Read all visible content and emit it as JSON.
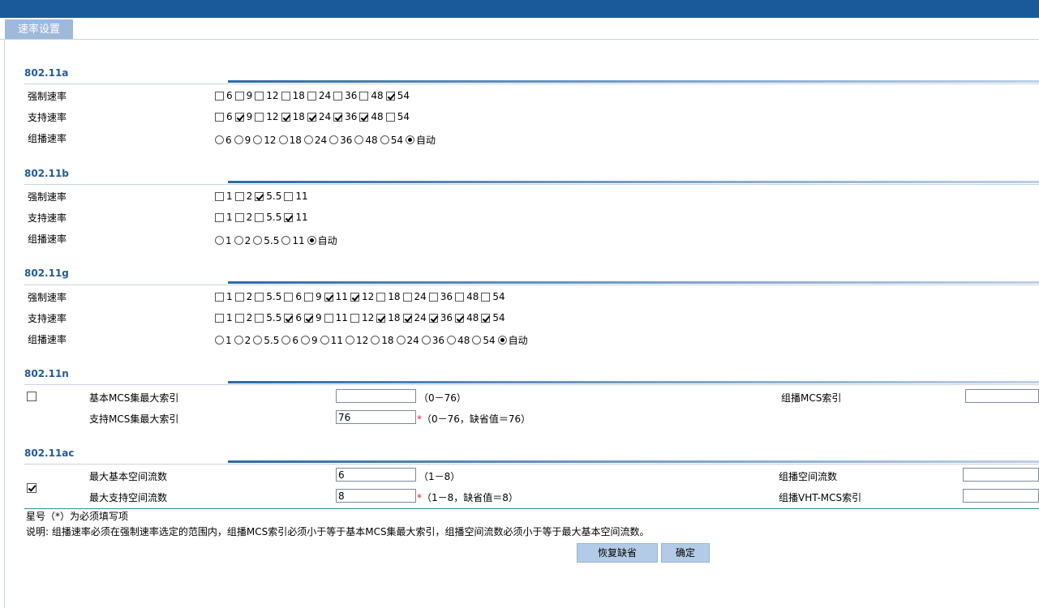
{
  "tab": {
    "label": "速率设置"
  },
  "labels": {
    "mandatory": "强制速率",
    "supported": "支持速率",
    "multicast": "组播速率"
  },
  "sections": [
    {
      "title": "802.11a",
      "mandatory": [
        {
          "v": "6",
          "on": false
        },
        {
          "v": "9",
          "on": false
        },
        {
          "v": "12",
          "on": false
        },
        {
          "v": "18",
          "on": false
        },
        {
          "v": "24",
          "on": false
        },
        {
          "v": "36",
          "on": false
        },
        {
          "v": "48",
          "on": false
        },
        {
          "v": "54",
          "on": true
        }
      ],
      "supported": [
        {
          "v": "6",
          "on": false
        },
        {
          "v": "9",
          "on": true
        },
        {
          "v": "12",
          "on": false
        },
        {
          "v": "18",
          "on": true
        },
        {
          "v": "24",
          "on": true
        },
        {
          "v": "36",
          "on": true
        },
        {
          "v": "48",
          "on": true
        },
        {
          "v": "54",
          "on": false
        }
      ],
      "multicast": [
        {
          "v": "6",
          "on": false
        },
        {
          "v": "9",
          "on": false
        },
        {
          "v": "12",
          "on": false
        },
        {
          "v": "18",
          "on": false
        },
        {
          "v": "24",
          "on": false
        },
        {
          "v": "36",
          "on": false
        },
        {
          "v": "48",
          "on": false
        },
        {
          "v": "54",
          "on": false
        },
        {
          "v": "自动",
          "on": true
        }
      ]
    },
    {
      "title": "802.11b",
      "mandatory": [
        {
          "v": "1",
          "on": false
        },
        {
          "v": "2",
          "on": false
        },
        {
          "v": "5.5",
          "on": true
        },
        {
          "v": "11",
          "on": false
        }
      ],
      "supported": [
        {
          "v": "1",
          "on": false
        },
        {
          "v": "2",
          "on": false
        },
        {
          "v": "5.5",
          "on": false
        },
        {
          "v": "11",
          "on": true
        }
      ],
      "multicast": [
        {
          "v": "1",
          "on": false
        },
        {
          "v": "2",
          "on": false
        },
        {
          "v": "5.5",
          "on": false
        },
        {
          "v": "11",
          "on": false
        },
        {
          "v": "自动",
          "on": true
        }
      ]
    },
    {
      "title": "802.11g",
      "mandatory": [
        {
          "v": "1",
          "on": false
        },
        {
          "v": "2",
          "on": false
        },
        {
          "v": "5.5",
          "on": false
        },
        {
          "v": "6",
          "on": false
        },
        {
          "v": "9",
          "on": false
        },
        {
          "v": "11",
          "on": true
        },
        {
          "v": "12",
          "on": true
        },
        {
          "v": "18",
          "on": false
        },
        {
          "v": "24",
          "on": false
        },
        {
          "v": "36",
          "on": false
        },
        {
          "v": "48",
          "on": false
        },
        {
          "v": "54",
          "on": false
        }
      ],
      "supported": [
        {
          "v": "1",
          "on": false
        },
        {
          "v": "2",
          "on": false
        },
        {
          "v": "5.5",
          "on": false
        },
        {
          "v": "6",
          "on": true
        },
        {
          "v": "9",
          "on": true
        },
        {
          "v": "11",
          "on": false
        },
        {
          "v": "12",
          "on": false
        },
        {
          "v": "18",
          "on": true
        },
        {
          "v": "24",
          "on": true
        },
        {
          "v": "36",
          "on": true
        },
        {
          "v": "48",
          "on": true
        },
        {
          "v": "54",
          "on": true
        }
      ],
      "multicast": [
        {
          "v": "1",
          "on": false
        },
        {
          "v": "2",
          "on": false
        },
        {
          "v": "5.5",
          "on": false
        },
        {
          "v": "6",
          "on": false
        },
        {
          "v": "9",
          "on": false
        },
        {
          "v": "11",
          "on": false
        },
        {
          "v": "12",
          "on": false
        },
        {
          "v": "18",
          "on": false
        },
        {
          "v": "24",
          "on": false
        },
        {
          "v": "36",
          "on": false
        },
        {
          "v": "48",
          "on": false
        },
        {
          "v": "54",
          "on": false
        },
        {
          "v": "自动",
          "on": true
        }
      ]
    }
  ],
  "n": {
    "title": "802.11n",
    "enabled": false,
    "basic_mcs_label": "基本MCS集最大索引",
    "basic_mcs_value": "",
    "basic_mcs_hint": "（0－76）",
    "support_mcs_label": "支持MCS集最大索引",
    "support_mcs_value": "76",
    "support_mcs_hint": "（0－76，缺省值＝76）",
    "mcast_mcs_label": "组播MCS索引",
    "mcast_mcs_value": ""
  },
  "ac": {
    "title": "802.11ac",
    "enabled": true,
    "max_basic_label": "最大基本空间流数",
    "max_basic_value": "6",
    "max_basic_hint": "（1－8）",
    "max_support_label": "最大支持空间流数",
    "max_support_value": "8",
    "max_support_hint": "（1－8，缺省值＝8）",
    "mcast_stream_label": "组播空间流数",
    "mcast_stream_value": "",
    "mcast_vht_label": "组播VHT-MCS索引",
    "mcast_vht_value": ""
  },
  "required_mark": "*",
  "note_required": "星号（*）为必须填写项",
  "note_desc": "说明: 组播速率必须在强制速率选定的范围内，组播MCS索引必须小于等于基本MCS集最大索引，组播空间流数必须小于等于最大基本空间流数。",
  "buttons": {
    "restore": "恢复缺省",
    "ok": "确定"
  }
}
